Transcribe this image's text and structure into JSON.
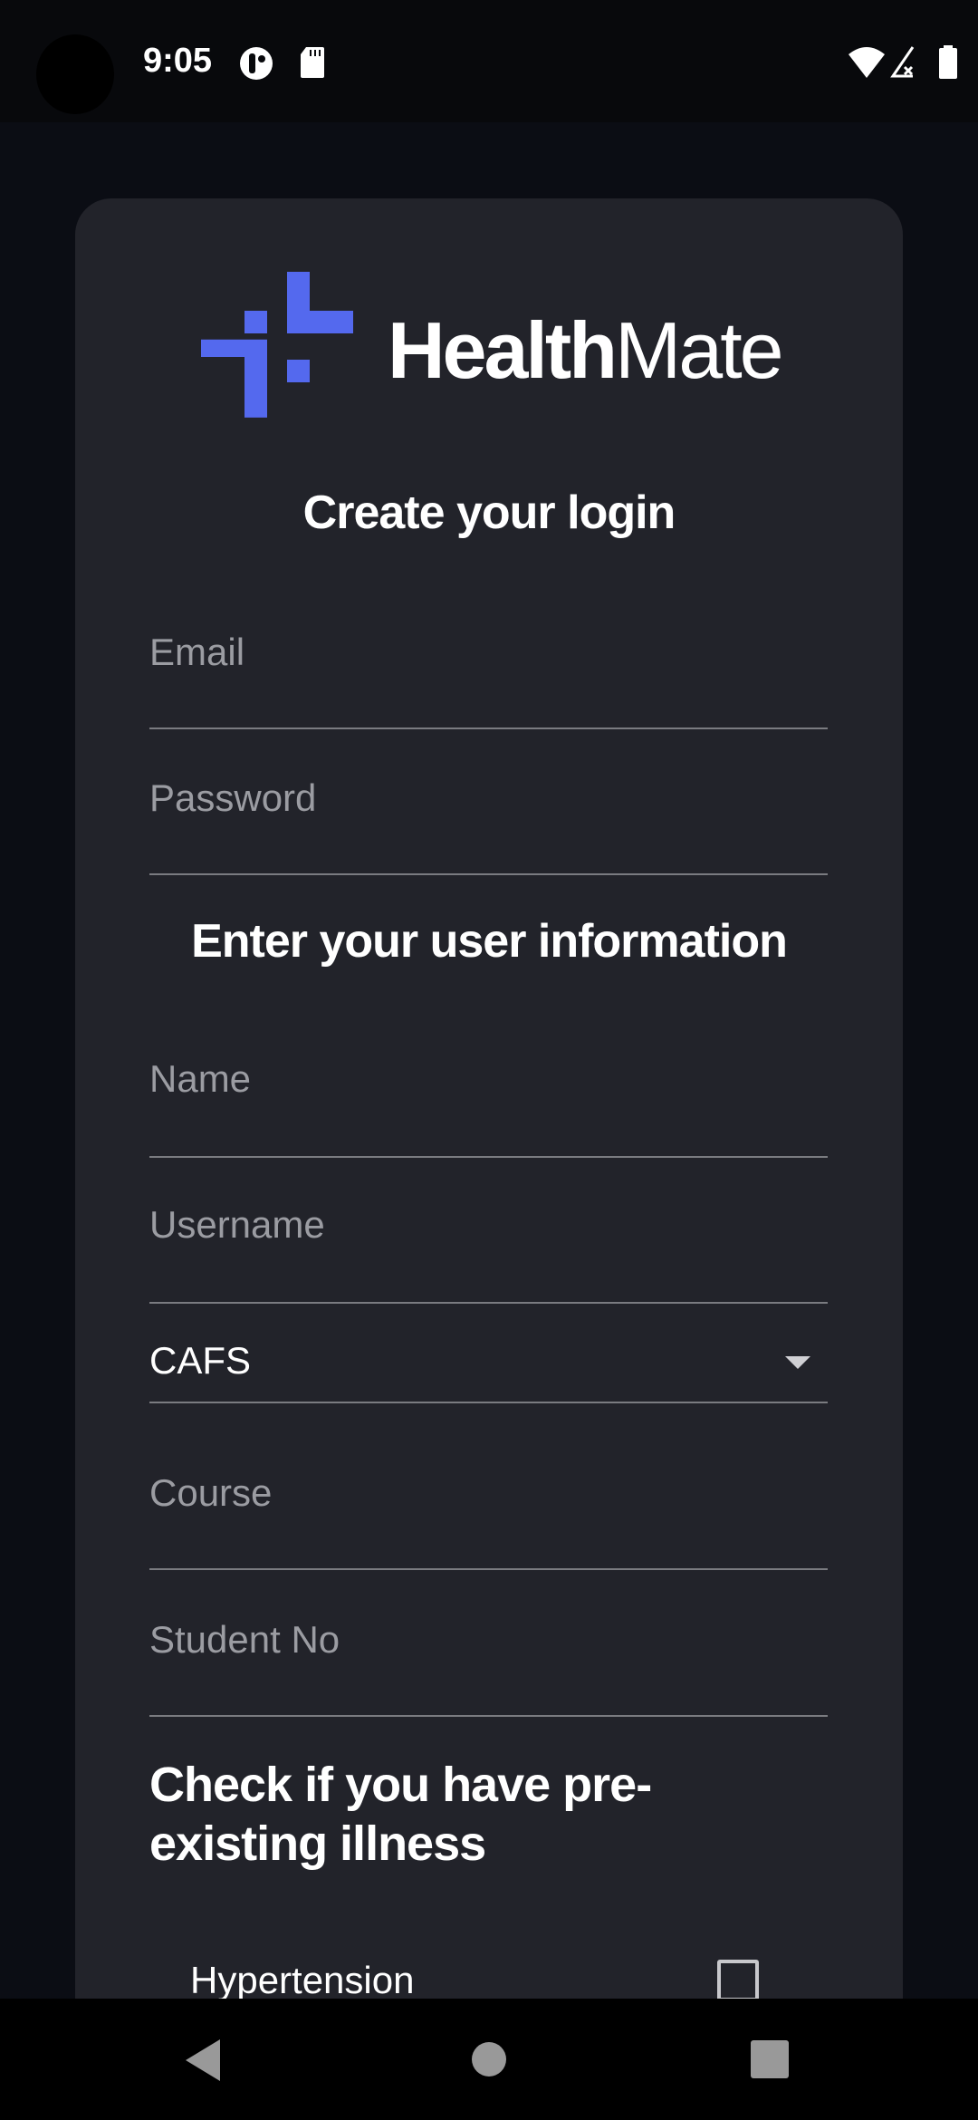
{
  "status_bar": {
    "time": "9:05",
    "icons": [
      "notification-app-icon",
      "sd-card-icon",
      "wifi-icon",
      "signal-no-service-icon",
      "battery-icon"
    ]
  },
  "brand": {
    "name_bold": "Health",
    "name_light": "Mate",
    "accent": "#5469ee"
  },
  "login": {
    "title": "Create your login",
    "email_placeholder": "Email",
    "password_placeholder": "Password"
  },
  "user_info": {
    "title": "Enter your user information",
    "name_placeholder": "Name",
    "username_placeholder": "Username",
    "college_selected": "CAFS",
    "course_placeholder": "Course",
    "student_no_placeholder": "Student No"
  },
  "illness": {
    "title": "Check if you have pre-existing illness",
    "items": [
      {
        "label": "Hypertension",
        "checked": false
      }
    ]
  }
}
